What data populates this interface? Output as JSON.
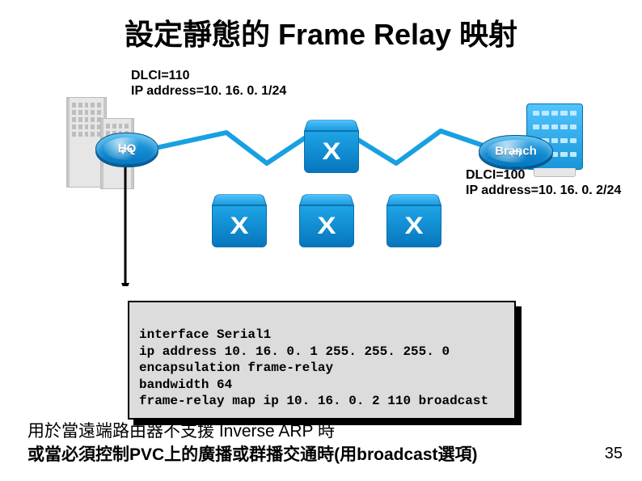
{
  "title": "設定靜態的 Frame Relay 映射",
  "hq": {
    "name": "HQ",
    "dlci": "DLCI=110",
    "ip": "IP address=10. 16. 0. 1/24"
  },
  "branch": {
    "name": "Branch",
    "dlci": "DLCI=100",
    "ip": "IP address=10. 16. 0. 2/24"
  },
  "config": {
    "l1": "interface Serial1",
    "l2": "ip address 10. 16. 0. 1 255. 255. 255. 0",
    "l3": "encapsulation frame-relay",
    "l4": "bandwidth 64",
    "l5": "frame-relay map ip 10. 16. 0. 2 110 broadcast"
  },
  "footer": {
    "line1": "用於當遠端路由器不支援 Inverse ARP 時",
    "line2": "或當必須控制PVC上的廣播或群播交通時(用broadcast選項)"
  },
  "pagenum": "35"
}
